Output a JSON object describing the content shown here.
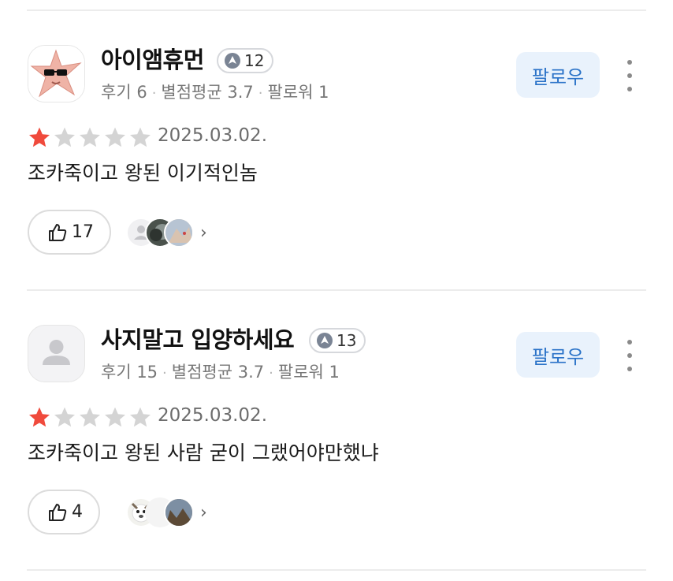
{
  "reviews": [
    {
      "username": "아이앰휴먼",
      "level": "12",
      "reviews_count": "후기 6",
      "avg_rating": "별점평균 3.7",
      "followers": "팔로워 1",
      "follow_label": "팔로우",
      "rating": 1,
      "max_rating": 5,
      "date": "2025.03.02.",
      "content": "조카죽이고 왕된 이기적인놈",
      "likes": "17",
      "avatar_icon": "starfish-sunglasses-avatar"
    },
    {
      "username": "사지말고 입양하세요",
      "level": "13",
      "reviews_count": "후기 15",
      "avg_rating": "별점평균 3.7",
      "followers": "팔로워 1",
      "follow_label": "팔로우",
      "rating": 1,
      "max_rating": 5,
      "date": "2025.03.02.",
      "content": "조카죽이고 왕된 사람 굳이 그랬어야만했냐",
      "likes": "4",
      "avatar_icon": "default-person-avatar"
    }
  ],
  "colors": {
    "star_filled": "#f04a3c",
    "star_empty": "#d4d4d4",
    "follow_bg": "#e9f2fc",
    "follow_text": "#2b73c8"
  }
}
